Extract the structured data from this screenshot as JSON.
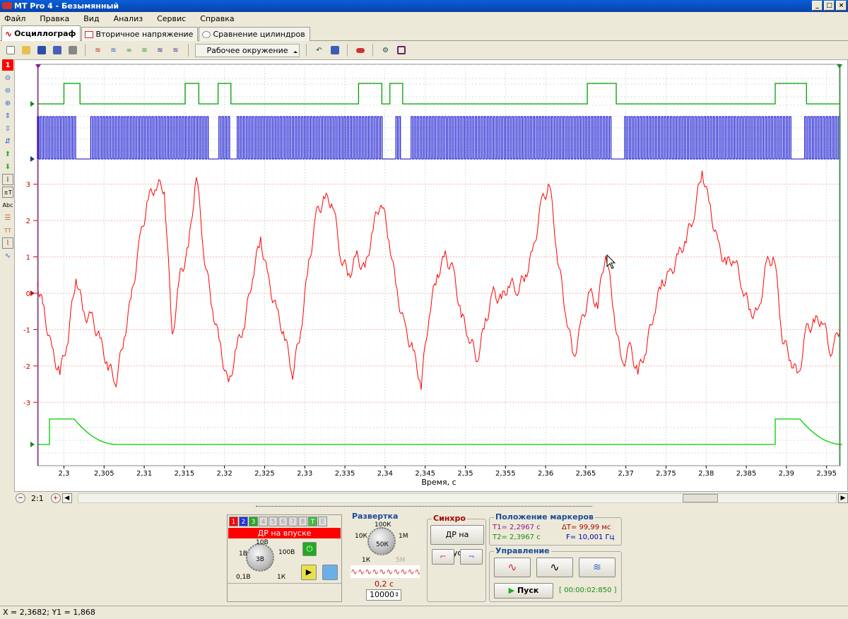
{
  "window": {
    "title": "MT Pro 4 - Безымянный"
  },
  "menu": [
    "Файл",
    "Правка",
    "Вид",
    "Анализ",
    "Сервис",
    "Справка"
  ],
  "tabs": [
    {
      "label": "Осциллограф"
    },
    {
      "label": "Вторичное напряжение"
    },
    {
      "label": "Сравнение цилиндров"
    }
  ],
  "toolbar": {
    "environment": "Рабочее окружение"
  },
  "channel_badge": "1",
  "chart_data": {
    "type": "line",
    "xlabel": "Время, с",
    "xlim": [
      2.2967,
      2.3967
    ],
    "x_ticks": [
      "2,3",
      "2,305",
      "2,31",
      "2,315",
      "2,32",
      "2,325",
      "2,33",
      "2,335",
      "2,34",
      "2,345",
      "2,35",
      "2,355",
      "2,36",
      "2,365",
      "2,37",
      "2,375",
      "2,38",
      "2,385",
      "2,39",
      "2,395"
    ],
    "y_ticks": [
      "3",
      "2",
      "1",
      "0",
      "-1",
      "-2",
      "-3"
    ],
    "ylim": [
      -3.5,
      3.5
    ],
    "grid": true,
    "series": [
      {
        "color": "#ff0000",
        "channel": 1,
        "x": [
          2.2967,
          2.2975,
          2.2985,
          2.2995,
          2.3005,
          2.3015,
          2.3025,
          2.3035,
          2.3045,
          2.3055,
          2.3065,
          2.3075,
          2.3085,
          2.3095,
          2.3105,
          2.3115,
          2.3125,
          2.3135,
          2.3145,
          2.3155,
          2.3165,
          2.3175,
          2.3185,
          2.3195,
          2.3205,
          2.3215,
          2.3225,
          2.3235,
          2.3245,
          2.3255,
          2.3265,
          2.3275,
          2.3285,
          2.3295,
          2.3305,
          2.3315,
          2.3325,
          2.3335,
          2.3345,
          2.3355,
          2.3365,
          2.3375,
          2.3385,
          2.3395,
          2.3405,
          2.3415,
          2.3425,
          2.3435,
          2.3445,
          2.3455,
          2.3465,
          2.3475,
          2.3485,
          2.3495,
          2.3505,
          2.3515,
          2.3525,
          2.3535,
          2.3545,
          2.3555,
          2.3565,
          2.3575,
          2.3585,
          2.3595,
          2.3605,
          2.3615,
          2.3625,
          2.3635,
          2.3645,
          2.3655,
          2.3665,
          2.3675,
          2.3685,
          2.3695,
          2.3705,
          2.3715,
          2.3725,
          2.3735,
          2.3745,
          2.3755,
          2.3765,
          2.3775,
          2.3785,
          2.3795,
          2.3805,
          2.3815,
          2.3825,
          2.3835,
          2.3845,
          2.3855,
          2.3865,
          2.3875,
          2.3885,
          2.3895,
          2.3905,
          2.3915,
          2.3925,
          2.3935,
          2.3945,
          2.3955,
          2.3967
        ],
        "y": [
          0.3,
          -0.5,
          -1.6,
          -2.2,
          -1.2,
          0.5,
          -0.6,
          -0.7,
          -1.3,
          -2.0,
          -2.4,
          -1.2,
          0.0,
          1.5,
          2.6,
          3.0,
          2.9,
          -1.2,
          0.5,
          1.2,
          3.3,
          1.0,
          -0.4,
          -1.5,
          -2.6,
          -1.5,
          -0.8,
          0.5,
          1.5,
          0.3,
          -0.5,
          -1.2,
          -2.2,
          -1.0,
          0.8,
          2.2,
          2.6,
          2.5,
          1.0,
          0.5,
          1.0,
          0.6,
          1.8,
          2.6,
          1.5,
          0.0,
          -1.0,
          -1.6,
          -2.5,
          -0.5,
          0.5,
          1.0,
          0.6,
          -0.6,
          -1.2,
          -1.8,
          -0.8,
          0.0,
          -0.2,
          0.3,
          0.1,
          0.5,
          1.2,
          2.5,
          3.0,
          1.0,
          -0.5,
          -1.8,
          -0.8,
          0.0,
          -0.3,
          1.2,
          -0.5,
          -2.0,
          -1.5,
          -2.2,
          -1.5,
          -0.5,
          0.3,
          0.5,
          1.0,
          1.5,
          2.2,
          3.4,
          2.3,
          1.3,
          0.8,
          1.0,
          0.2,
          -0.5,
          -0.6,
          0.8,
          1.0,
          -1.2,
          -1.8,
          -2.3,
          -1.0,
          -0.8,
          -0.7,
          -1.6,
          -1.0
        ]
      },
      {
        "color": "#00a000",
        "channel": 3,
        "shape": "gate",
        "high_windows": [
          [
            2.3,
            2.302
          ],
          [
            2.3151,
            2.3168
          ],
          [
            2.3192,
            2.3208
          ],
          [
            2.3367,
            2.3396
          ],
          [
            2.3406,
            2.3422
          ],
          [
            2.3652,
            2.3688
          ],
          [
            2.3886,
            2.3925
          ]
        ]
      },
      {
        "color": "#0000cc",
        "channel": 2,
        "shape": "square",
        "gaps": [
          [
            2.3015,
            2.3032
          ],
          [
            2.318,
            2.3193
          ],
          [
            2.3206,
            2.3215
          ],
          [
            2.3395,
            2.3412
          ],
          [
            2.342,
            2.3432
          ],
          [
            2.368,
            2.3697
          ],
          [
            2.3905,
            2.3922
          ]
        ]
      },
      {
        "color": "#00cc00",
        "channel": 4,
        "shape": "step",
        "pulses": [
          [
            2.2982,
            2.301
          ],
          [
            2.3886,
            2.3967
          ]
        ]
      }
    ]
  },
  "scroll": {
    "zoom": "2:1"
  },
  "channel_panel": {
    "tabs": [
      "1",
      "2",
      "3",
      "4",
      "5",
      "6",
      "7",
      "8",
      "T",
      "E"
    ],
    "name": "ДР на впуске",
    "knob_labels": [
      "10В",
      "100В",
      "1В",
      "0,1В",
      "1К",
      "3В"
    ]
  },
  "sweep": {
    "title": "Развертка",
    "labels": [
      "100К",
      "10К",
      "1М",
      "50К",
      "1К",
      "5М"
    ],
    "period": "0,2 с",
    "points": "10000"
  },
  "sync": {
    "title": "Синхро",
    "source": "ДР на впуске"
  },
  "markers": {
    "title": "Положение маркеров",
    "t1": "T1= 2,2967 с",
    "t2": "T2= 2,3967 с",
    "dt": "ΔT= 99,99 мс",
    "freq": "F= 10,001 Гц"
  },
  "control": {
    "title": "Управление",
    "run": "Пуск",
    "timer": "[ 00:00:02:850 ]"
  },
  "status": "X = 2,3682; Y1 = 1,868"
}
